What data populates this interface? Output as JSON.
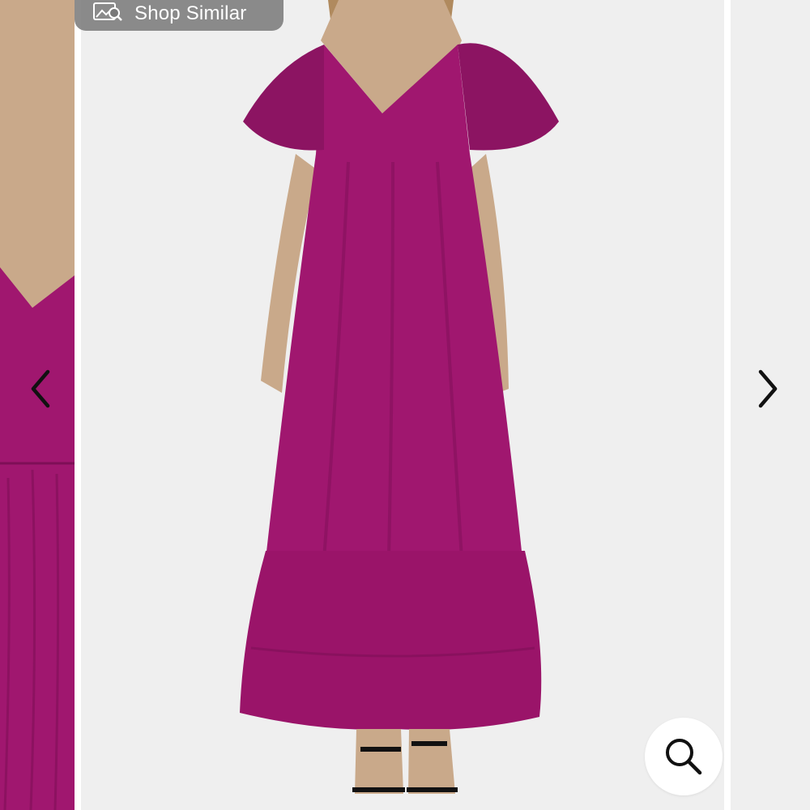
{
  "toolbar": {
    "shop_similar_label": "Shop Similar"
  },
  "carousel": {
    "prev_icon": "chevron-left-icon",
    "next_icon": "chevron-right-icon",
    "zoom_icon": "magnifier-icon"
  },
  "colors": {
    "dress": "#a0176f",
    "dress_dark": "#7e0f57",
    "background": "#efefef",
    "skin": "#c9a98a"
  }
}
